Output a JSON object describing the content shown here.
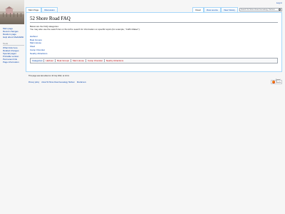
{
  "personal": {
    "login": "Log in"
  },
  "sidebar": {
    "nav": [
      "Main page",
      "Recent changes",
      "Random page",
      "Help about MediaWiki"
    ],
    "tools_heading": "Tools",
    "tools": [
      "What links here",
      "Related changes",
      "Special pages",
      "Printable version",
      "Permanent link",
      "Page information"
    ]
  },
  "tabs": {
    "left": [
      "Main Page",
      "Discussion"
    ],
    "right": [
      "Read",
      "View source",
      "View history"
    ]
  },
  "search": {
    "placeholder": "Search 52 Shore Road Genealogy Harbour"
  },
  "page": {
    "title": "52 Shore Road FAQ",
    "intro1": "Below are the FAQ categories:",
    "intro2": "You may also use the search bar on the left to search for information on specific topics (for example, \"Coffin Maker\").",
    "categories": [
      "Harbour",
      "Boat Groups",
      "Main House",
      "Shed",
      "Camp Chocolat",
      "Nearby Attractions"
    ]
  },
  "catlinks": {
    "label": "Categories:",
    "items": [
      "Harbour",
      "Boat Groups",
      "Main House",
      "Camp Chocolat",
      "Nearby Attractions"
    ]
  },
  "footer": {
    "modified": "This page was last edited on 16 July 2022, at 14:11.",
    "places": [
      "Privacy policy",
      "About 52 Shore Road Genealogy Harbour",
      "Disclaimers"
    ],
    "powered": "Powered by MediaWiki"
  }
}
